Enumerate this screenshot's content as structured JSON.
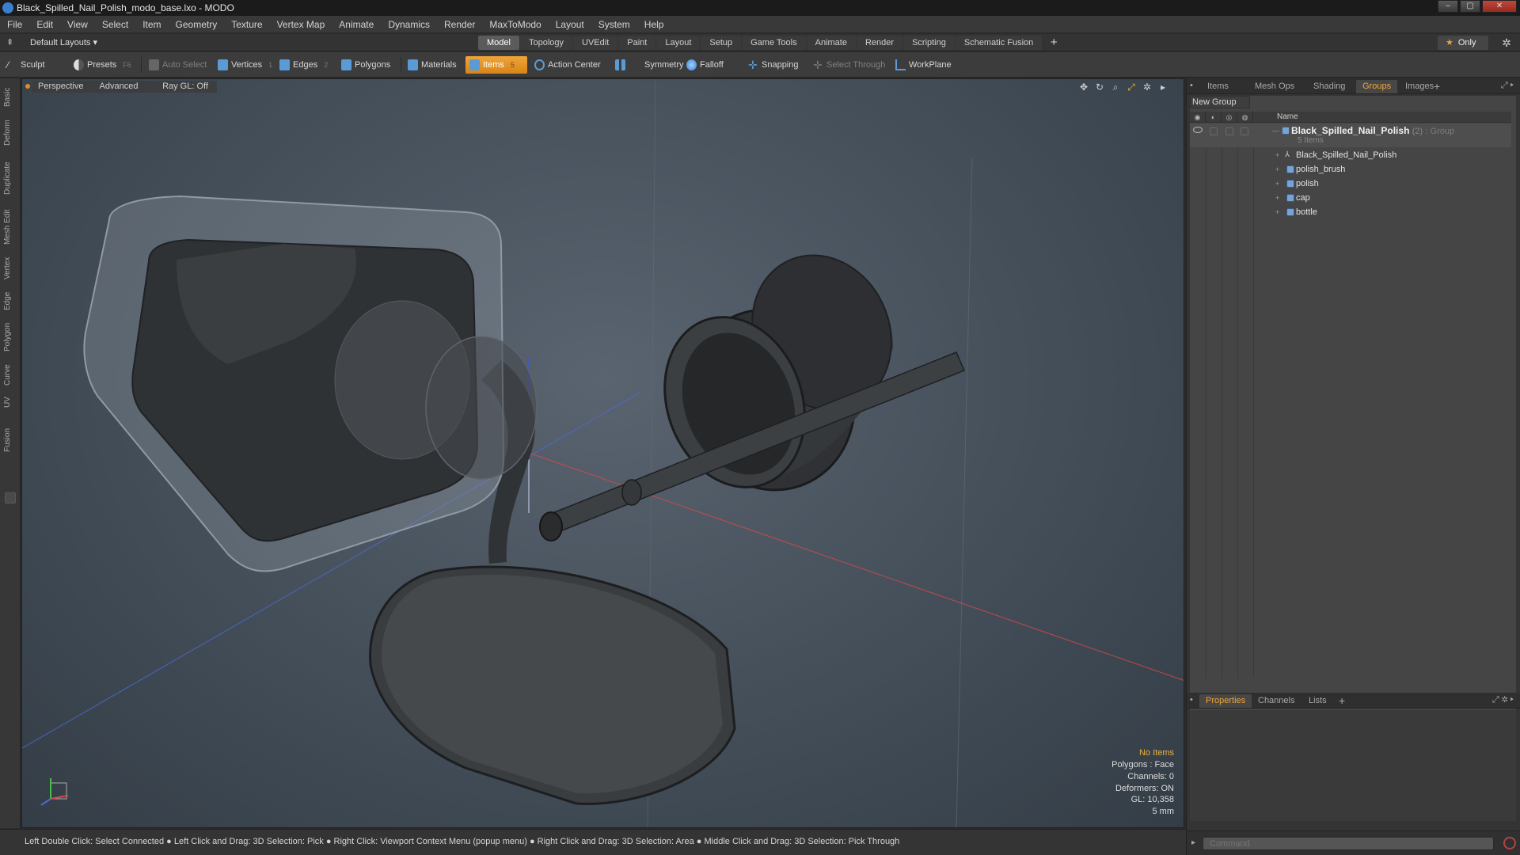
{
  "window": {
    "title": "Black_Spilled_Nail_Polish_modo_base.lxo - MODO",
    "buttons": [
      "–",
      "▢",
      "✕"
    ]
  },
  "menubar": [
    "File",
    "Edit",
    "View",
    "Select",
    "Item",
    "Geometry",
    "Texture",
    "Vertex Map",
    "Animate",
    "Dynamics",
    "Render",
    "MaxToModo",
    "Layout",
    "System",
    "Help"
  ],
  "layoutbar": {
    "layout_select": "Default Layouts ▾",
    "tabs": [
      "Model",
      "Topology",
      "UVEdit",
      "Paint",
      "Layout",
      "Setup",
      "Game Tools",
      "Animate",
      "Render",
      "Scripting",
      "Schematic Fusion"
    ],
    "active_tab": "Model",
    "add_tab": "+",
    "only_label": "Only",
    "star": "★"
  },
  "toolbar": {
    "sculpt": "Sculpt",
    "presets": "Presets",
    "presets_key": "F6",
    "auto_select": "Auto Select",
    "vertices": "Vertices",
    "vertices_key": "1",
    "edges": "Edges",
    "edges_key": "2",
    "polygons": "Polygons",
    "materials": "Materials",
    "items": "Items",
    "items_key": "5",
    "action_center": "Action Center",
    "symmetry": "Symmetry",
    "falloff": "Falloff",
    "snapping": "Snapping",
    "select_through": "Select Through",
    "workplane": "WorkPlane",
    "colors": {
      "active": "#f0a539",
      "accent_blue": "#5b9bd5"
    }
  },
  "left_tabs": [
    "Basic",
    "Deform",
    "Duplicate",
    "Mesh Edit",
    "Vertex",
    "Edge",
    "Polygon",
    "Curve",
    "UV",
    "Fusion"
  ],
  "viewport": {
    "view": "Perspective",
    "mode": "Advanced",
    "raygl": "Ray GL: Off",
    "icons": [
      "move-view-icon",
      "rotate-view-icon",
      "zoom-view-icon",
      "fit-view-icon",
      "settings-icon",
      "expand-icon"
    ],
    "info": {
      "no_items": "No Items",
      "polygons": "Polygons : Face",
      "channels": "Channels: 0",
      "deformers": "Deformers: ON",
      "gl": "GL: 10,358",
      "unit": "5 mm"
    }
  },
  "statusbar": {
    "text": "Left Double Click: Select Connected ● Left Click and Drag: 3D Selection: Pick ● Right Click: Viewport Context Menu (popup menu) ● Right Click and Drag: 3D Selection: Area ● Middle Click and Drag: 3D Selection: Pick Through"
  },
  "rightpanel": {
    "top_tabs": [
      "Items",
      "Mesh Ops",
      "Shading",
      "Groups",
      "Images"
    ],
    "active_top_tab": "Groups",
    "new_group": "New Group",
    "name_header": "Name",
    "group": {
      "name": "Black_Spilled_Nail_Polish",
      "count": "(2)",
      "type": ": Group",
      "sub": "5 Items"
    },
    "items": [
      {
        "label": "Black_Spilled_Nail_Polish",
        "icon": "locator-icon"
      },
      {
        "label": "polish_brush",
        "icon": "mesh-icon"
      },
      {
        "label": "polish",
        "icon": "mesh-icon"
      },
      {
        "label": "cap",
        "icon": "mesh-icon"
      },
      {
        "label": "bottle",
        "icon": "mesh-icon"
      }
    ],
    "bottom_tabs": [
      "Properties",
      "Channels",
      "Lists"
    ],
    "active_bottom_tab": "Properties",
    "command_placeholder": "Command"
  }
}
